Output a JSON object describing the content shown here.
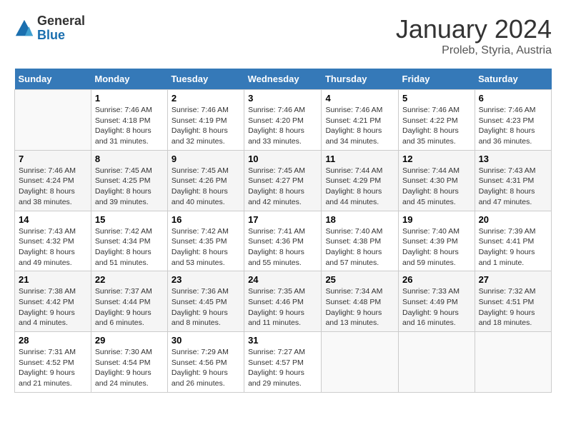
{
  "header": {
    "logo_general": "General",
    "logo_blue": "Blue",
    "month_title": "January 2024",
    "subtitle": "Proleb, Styria, Austria"
  },
  "columns": [
    "Sunday",
    "Monday",
    "Tuesday",
    "Wednesday",
    "Thursday",
    "Friday",
    "Saturday"
  ],
  "weeks": [
    [
      {
        "day": "",
        "info": ""
      },
      {
        "day": "1",
        "info": "Sunrise: 7:46 AM\nSunset: 4:18 PM\nDaylight: 8 hours\nand 31 minutes."
      },
      {
        "day": "2",
        "info": "Sunrise: 7:46 AM\nSunset: 4:19 PM\nDaylight: 8 hours\nand 32 minutes."
      },
      {
        "day": "3",
        "info": "Sunrise: 7:46 AM\nSunset: 4:20 PM\nDaylight: 8 hours\nand 33 minutes."
      },
      {
        "day": "4",
        "info": "Sunrise: 7:46 AM\nSunset: 4:21 PM\nDaylight: 8 hours\nand 34 minutes."
      },
      {
        "day": "5",
        "info": "Sunrise: 7:46 AM\nSunset: 4:22 PM\nDaylight: 8 hours\nand 35 minutes."
      },
      {
        "day": "6",
        "info": "Sunrise: 7:46 AM\nSunset: 4:23 PM\nDaylight: 8 hours\nand 36 minutes."
      }
    ],
    [
      {
        "day": "7",
        "info": "Sunrise: 7:46 AM\nSunset: 4:24 PM\nDaylight: 8 hours\nand 38 minutes."
      },
      {
        "day": "8",
        "info": "Sunrise: 7:45 AM\nSunset: 4:25 PM\nDaylight: 8 hours\nand 39 minutes."
      },
      {
        "day": "9",
        "info": "Sunrise: 7:45 AM\nSunset: 4:26 PM\nDaylight: 8 hours\nand 40 minutes."
      },
      {
        "day": "10",
        "info": "Sunrise: 7:45 AM\nSunset: 4:27 PM\nDaylight: 8 hours\nand 42 minutes."
      },
      {
        "day": "11",
        "info": "Sunrise: 7:44 AM\nSunset: 4:29 PM\nDaylight: 8 hours\nand 44 minutes."
      },
      {
        "day": "12",
        "info": "Sunrise: 7:44 AM\nSunset: 4:30 PM\nDaylight: 8 hours\nand 45 minutes."
      },
      {
        "day": "13",
        "info": "Sunrise: 7:43 AM\nSunset: 4:31 PM\nDaylight: 8 hours\nand 47 minutes."
      }
    ],
    [
      {
        "day": "14",
        "info": "Sunrise: 7:43 AM\nSunset: 4:32 PM\nDaylight: 8 hours\nand 49 minutes."
      },
      {
        "day": "15",
        "info": "Sunrise: 7:42 AM\nSunset: 4:34 PM\nDaylight: 8 hours\nand 51 minutes."
      },
      {
        "day": "16",
        "info": "Sunrise: 7:42 AM\nSunset: 4:35 PM\nDaylight: 8 hours\nand 53 minutes."
      },
      {
        "day": "17",
        "info": "Sunrise: 7:41 AM\nSunset: 4:36 PM\nDaylight: 8 hours\nand 55 minutes."
      },
      {
        "day": "18",
        "info": "Sunrise: 7:40 AM\nSunset: 4:38 PM\nDaylight: 8 hours\nand 57 minutes."
      },
      {
        "day": "19",
        "info": "Sunrise: 7:40 AM\nSunset: 4:39 PM\nDaylight: 8 hours\nand 59 minutes."
      },
      {
        "day": "20",
        "info": "Sunrise: 7:39 AM\nSunset: 4:41 PM\nDaylight: 9 hours\nand 1 minute."
      }
    ],
    [
      {
        "day": "21",
        "info": "Sunrise: 7:38 AM\nSunset: 4:42 PM\nDaylight: 9 hours\nand 4 minutes."
      },
      {
        "day": "22",
        "info": "Sunrise: 7:37 AM\nSunset: 4:44 PM\nDaylight: 9 hours\nand 6 minutes."
      },
      {
        "day": "23",
        "info": "Sunrise: 7:36 AM\nSunset: 4:45 PM\nDaylight: 9 hours\nand 8 minutes."
      },
      {
        "day": "24",
        "info": "Sunrise: 7:35 AM\nSunset: 4:46 PM\nDaylight: 9 hours\nand 11 minutes."
      },
      {
        "day": "25",
        "info": "Sunrise: 7:34 AM\nSunset: 4:48 PM\nDaylight: 9 hours\nand 13 minutes."
      },
      {
        "day": "26",
        "info": "Sunrise: 7:33 AM\nSunset: 4:49 PM\nDaylight: 9 hours\nand 16 minutes."
      },
      {
        "day": "27",
        "info": "Sunrise: 7:32 AM\nSunset: 4:51 PM\nDaylight: 9 hours\nand 18 minutes."
      }
    ],
    [
      {
        "day": "28",
        "info": "Sunrise: 7:31 AM\nSunset: 4:52 PM\nDaylight: 9 hours\nand 21 minutes."
      },
      {
        "day": "29",
        "info": "Sunrise: 7:30 AM\nSunset: 4:54 PM\nDaylight: 9 hours\nand 24 minutes."
      },
      {
        "day": "30",
        "info": "Sunrise: 7:29 AM\nSunset: 4:56 PM\nDaylight: 9 hours\nand 26 minutes."
      },
      {
        "day": "31",
        "info": "Sunrise: 7:27 AM\nSunset: 4:57 PM\nDaylight: 9 hours\nand 29 minutes."
      },
      {
        "day": "",
        "info": ""
      },
      {
        "day": "",
        "info": ""
      },
      {
        "day": "",
        "info": ""
      }
    ]
  ]
}
